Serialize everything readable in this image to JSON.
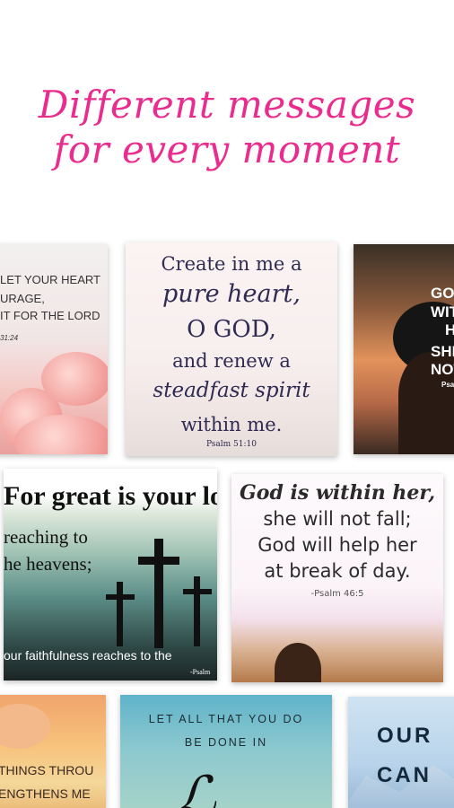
{
  "headline": {
    "line1": "Different messages",
    "line2": "for every moment",
    "color": "#ea2c8f"
  },
  "cards": {
    "heart": {
      "lines": [
        "LET YOUR HEART",
        "URAGE,",
        "IT FOR THE LORD",
        "31:24"
      ]
    },
    "pure": {
      "lines": [
        "Create in me a",
        "pure heart,",
        "O GOD,",
        "and renew a",
        "steadfast spirit",
        "within me.",
        "Psalm 51:10"
      ]
    },
    "silhouette": {
      "lines": [
        "GO",
        "WIT",
        "H",
        "SHE",
        "NOT",
        "Psa"
      ]
    },
    "cross": {
      "lines": [
        "For great is your lo",
        "reaching to",
        "he heavens;",
        "our faithfulness reaches to the",
        "-Psalm"
      ]
    },
    "within": {
      "lines": [
        "God is within her,",
        "she will not fall;",
        "God will help her",
        "at break of day.",
        "-Psalm 46:5"
      ]
    },
    "things": {
      "lines": [
        "THINGS THROU",
        "ENGTHENS ME"
      ]
    },
    "let": {
      "lines": [
        "LET ALL THAT YOU DO",
        "BE DONE IN"
      ]
    },
    "our": {
      "lines": [
        "OUR",
        "CAN"
      ]
    }
  }
}
